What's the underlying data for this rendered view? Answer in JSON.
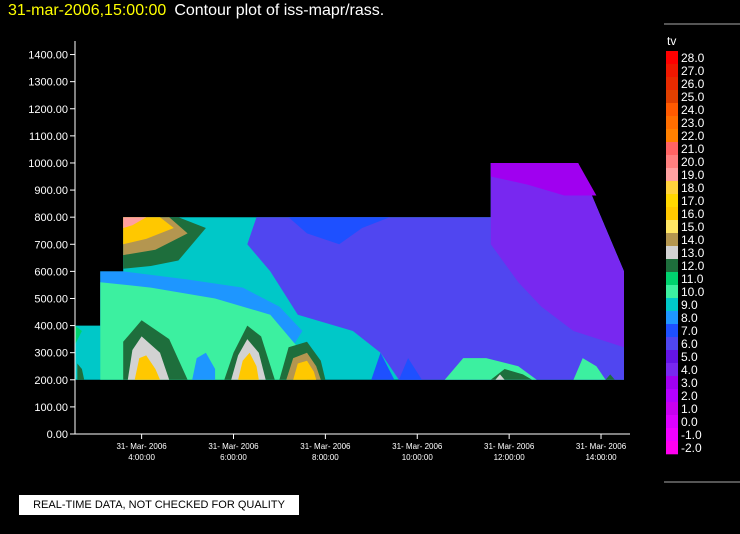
{
  "header": {
    "timestamp": "31-mar-2006,15:00:00",
    "title": "Contour plot of iss-mapr/rass."
  },
  "footer": {
    "quality_note": "REAL-TIME DATA, NOT CHECKED FOR QUALITY"
  },
  "chart_data": {
    "type": "heatmap",
    "title": "Contour plot of iss-mapr/rass.",
    "xlabel": "",
    "ylabel": "",
    "x_range_hours": [
      2.55,
      14.5
    ],
    "ylim": [
      0,
      1450
    ],
    "y_ticks": [
      "0.00",
      "100.00",
      "200.00",
      "300.00",
      "400.00",
      "500.00",
      "600.00",
      "700.00",
      "800.00",
      "900.00",
      "1000.00",
      "1100.00",
      "1200.00",
      "1300.00",
      "1400.00"
    ],
    "x_ticks": [
      {
        "hour": 4,
        "date": "31- Mar- 2006",
        "time": "4:00:00"
      },
      {
        "hour": 6,
        "date": "31- Mar- 2006",
        "time": "6:00:00"
      },
      {
        "hour": 8,
        "date": "31- Mar- 2006",
        "time": "8:00:00"
      },
      {
        "hour": 10,
        "date": "31- Mar- 2006",
        "time": "10:00:00"
      },
      {
        "hour": 12,
        "date": "31- Mar- 2006",
        "time": "12:00:00"
      },
      {
        "hour": 14,
        "date": "31- Mar- 2006",
        "time": "14:00:00"
      }
    ],
    "grid": false,
    "legend": {
      "title": "tv",
      "placement": "right",
      "levels": [
        "28.0",
        "27.0",
        "26.0",
        "25.0",
        "24.0",
        "23.0",
        "22.0",
        "21.0",
        "20.0",
        "19.0",
        "18.0",
        "17.0",
        "16.0",
        "15.0",
        "14.0",
        "13.0",
        "12.0",
        "11.0",
        "10.0",
        "9.0",
        "8.0",
        "7.0",
        "6.0",
        "5.0",
        "4.0",
        "3.0",
        "2.0",
        "1.0",
        "0.0",
        "-1.0",
        "-2.0"
      ],
      "colors": [
        "#ff0000",
        "#f01800",
        "#e82a00",
        "#e04000",
        "#ff5a00",
        "#ff6e00",
        "#ff8000",
        "#ff6464",
        "#ff8080",
        "#ffa0a0",
        "#ffd23c",
        "#ffd700",
        "#ffc800",
        "#ffe664",
        "#b49650",
        "#d2d2d2",
        "#1e6e3c",
        "#00d26e",
        "#3cf0a0",
        "#00c8c8",
        "#1e96ff",
        "#1e50ff",
        "#5046f0",
        "#6414e6",
        "#7828f0",
        "#a000f0",
        "#b400ff",
        "#c800f0",
        "#dc00ff",
        "#f000ff",
        "#ff00f0"
      ]
    },
    "data_extent": [
      {
        "hour": 2.55,
        "height": 200
      },
      {
        "hour": 2.55,
        "height": 400
      },
      {
        "hour": 3.1,
        "height": 400
      },
      {
        "hour": 3.1,
        "height": 600
      },
      {
        "hour": 3.6,
        "height": 600
      },
      {
        "hour": 3.6,
        "height": 800
      },
      {
        "hour": 11.6,
        "height": 800
      },
      {
        "hour": 11.6,
        "height": 1000
      },
      {
        "hour": 13.5,
        "height": 1000
      },
      {
        "hour": 14.5,
        "height": 600
      },
      {
        "hour": 14.5,
        "height": 200
      }
    ],
    "contour_regions": [
      {
        "level": "9.0",
        "points": [
          [
            2.55,
            200
          ],
          [
            2.55,
            400
          ],
          [
            3.1,
            400
          ],
          [
            3.1,
            600
          ],
          [
            3.6,
            600
          ],
          [
            3.6,
            800
          ],
          [
            11.6,
            800
          ],
          [
            11.6,
            1000
          ],
          [
            13.5,
            1000
          ],
          [
            14.5,
            600
          ],
          [
            14.5,
            200
          ]
        ]
      },
      {
        "level": "6.0",
        "points": [
          [
            6.5,
            800
          ],
          [
            11.6,
            800
          ],
          [
            11.6,
            1000
          ],
          [
            13.5,
            1000
          ],
          [
            14.5,
            600
          ],
          [
            14.5,
            200
          ],
          [
            9.6,
            200
          ],
          [
            9.2,
            300
          ],
          [
            8.6,
            380
          ],
          [
            7.4,
            440
          ],
          [
            6.8,
            600
          ],
          [
            6.3,
            700
          ]
        ]
      },
      {
        "level": "4.0",
        "points": [
          [
            11.6,
            700
          ],
          [
            11.6,
            1000
          ],
          [
            13.5,
            1000
          ],
          [
            14.5,
            600
          ],
          [
            14.5,
            320
          ],
          [
            13.4,
            380
          ],
          [
            12.7,
            470
          ],
          [
            12.2,
            560
          ]
        ]
      },
      {
        "level": "3.0",
        "points": [
          [
            11.6,
            950
          ],
          [
            11.6,
            1000
          ],
          [
            13.5,
            1000
          ],
          [
            13.9,
            880
          ],
          [
            13.2,
            880
          ],
          [
            12.4,
            920
          ]
        ]
      },
      {
        "level": "7.0",
        "points": [
          [
            7.2,
            800
          ],
          [
            7.6,
            740
          ],
          [
            8.3,
            700
          ],
          [
            8.8,
            760
          ],
          [
            9.4,
            800
          ]
        ]
      },
      {
        "level": "8.0",
        "points": [
          [
            3.1,
            400
          ],
          [
            3.1,
            600
          ],
          [
            3.6,
            600
          ],
          [
            5.0,
            570
          ],
          [
            6.2,
            540
          ],
          [
            7.0,
            470
          ],
          [
            7.5,
            380
          ],
          [
            7.2,
            300
          ],
          [
            6.0,
            320
          ],
          [
            5.0,
            350
          ],
          [
            4.0,
            400
          ]
        ]
      },
      {
        "level": "10.0",
        "points": [
          [
            3.1,
            200
          ],
          [
            3.1,
            560
          ],
          [
            4.2,
            540
          ],
          [
            5.6,
            500
          ],
          [
            6.8,
            440
          ],
          [
            7.4,
            320
          ],
          [
            7.6,
            200
          ]
        ]
      },
      {
        "level": "12.0",
        "points": [
          [
            3.6,
            610
          ],
          [
            3.6,
            800
          ],
          [
            4.8,
            800
          ],
          [
            5.4,
            760
          ],
          [
            4.8,
            640
          ],
          [
            4.2,
            620
          ]
        ]
      },
      {
        "level": "14.0",
        "points": [
          [
            3.6,
            660
          ],
          [
            3.6,
            800
          ],
          [
            4.6,
            800
          ],
          [
            5.0,
            740
          ],
          [
            4.3,
            680
          ]
        ]
      },
      {
        "level": "16.0",
        "points": [
          [
            3.6,
            700
          ],
          [
            3.6,
            800
          ],
          [
            4.4,
            800
          ],
          [
            4.7,
            760
          ],
          [
            4.1,
            720
          ]
        ]
      },
      {
        "level": "19.0",
        "points": [
          [
            3.6,
            760
          ],
          [
            3.6,
            800
          ],
          [
            4.1,
            800
          ],
          [
            3.8,
            770
          ]
        ]
      },
      {
        "level": "11.0",
        "points": [
          [
            2.55,
            330
          ],
          [
            2.55,
            400
          ],
          [
            2.7,
            380
          ]
        ]
      },
      {
        "level": "12.0",
        "points": [
          [
            2.6,
            200
          ],
          [
            2.6,
            260
          ],
          [
            2.7,
            240
          ],
          [
            2.75,
            200
          ]
        ]
      },
      {
        "level": "12.0",
        "points": [
          [
            3.6,
            200
          ],
          [
            3.6,
            340
          ],
          [
            4.0,
            420
          ],
          [
            4.6,
            350
          ],
          [
            5.0,
            200
          ]
        ]
      },
      {
        "level": "13.0",
        "points": [
          [
            3.7,
            200
          ],
          [
            3.8,
            310
          ],
          [
            4.0,
            360
          ],
          [
            4.4,
            300
          ],
          [
            4.6,
            200
          ]
        ]
      },
      {
        "level": "16.0",
        "points": [
          [
            3.85,
            200
          ],
          [
            3.95,
            280
          ],
          [
            4.1,
            290
          ],
          [
            4.3,
            240
          ],
          [
            4.4,
            200
          ]
        ]
      },
      {
        "level": "8.0",
        "points": [
          [
            5.1,
            200
          ],
          [
            5.2,
            280
          ],
          [
            5.4,
            300
          ],
          [
            5.6,
            240
          ],
          [
            5.6,
            200
          ]
        ]
      },
      {
        "level": "12.0",
        "points": [
          [
            5.8,
            200
          ],
          [
            6.0,
            300
          ],
          [
            6.3,
            400
          ],
          [
            6.6,
            360
          ],
          [
            6.9,
            200
          ]
        ]
      },
      {
        "level": "13.0",
        "points": [
          [
            5.95,
            200
          ],
          [
            6.1,
            290
          ],
          [
            6.3,
            350
          ],
          [
            6.55,
            300
          ],
          [
            6.7,
            200
          ]
        ]
      },
      {
        "level": "16.0",
        "points": [
          [
            6.1,
            200
          ],
          [
            6.2,
            270
          ],
          [
            6.35,
            300
          ],
          [
            6.5,
            250
          ],
          [
            6.55,
            200
          ]
        ]
      },
      {
        "level": "12.0",
        "points": [
          [
            7.0,
            200
          ],
          [
            7.2,
            320
          ],
          [
            7.6,
            340
          ],
          [
            7.9,
            270
          ],
          [
            8.0,
            200
          ]
        ]
      },
      {
        "level": "14.0",
        "points": [
          [
            7.15,
            200
          ],
          [
            7.3,
            280
          ],
          [
            7.6,
            300
          ],
          [
            7.8,
            250
          ],
          [
            7.9,
            200
          ]
        ]
      },
      {
        "level": "16.0",
        "points": [
          [
            7.3,
            200
          ],
          [
            7.4,
            260
          ],
          [
            7.6,
            270
          ],
          [
            7.75,
            230
          ],
          [
            7.8,
            200
          ]
        ]
      },
      {
        "level": "7.0",
        "points": [
          [
            9.0,
            200
          ],
          [
            9.2,
            300
          ],
          [
            9.5,
            200
          ]
        ]
      },
      {
        "level": "7.0",
        "points": [
          [
            9.6,
            200
          ],
          [
            9.8,
            280
          ],
          [
            10.1,
            200
          ]
        ]
      },
      {
        "level": "10.0",
        "points": [
          [
            10.6,
            200
          ],
          [
            11.0,
            280
          ],
          [
            11.5,
            280
          ],
          [
            12.2,
            250
          ],
          [
            12.6,
            200
          ]
        ]
      },
      {
        "level": "12.0",
        "points": [
          [
            11.6,
            200
          ],
          [
            11.9,
            240
          ],
          [
            12.3,
            220
          ],
          [
            12.5,
            200
          ]
        ]
      },
      {
        "level": "13.0",
        "points": [
          [
            11.7,
            200
          ],
          [
            11.8,
            220
          ],
          [
            11.9,
            200
          ]
        ]
      },
      {
        "level": "10.0",
        "points": [
          [
            13.4,
            200
          ],
          [
            13.6,
            280
          ],
          [
            13.9,
            250
          ],
          [
            14.1,
            200
          ]
        ]
      },
      {
        "level": "12.0",
        "points": [
          [
            14.1,
            200
          ],
          [
            14.2,
            220
          ],
          [
            14.3,
            200
          ]
        ]
      }
    ]
  }
}
